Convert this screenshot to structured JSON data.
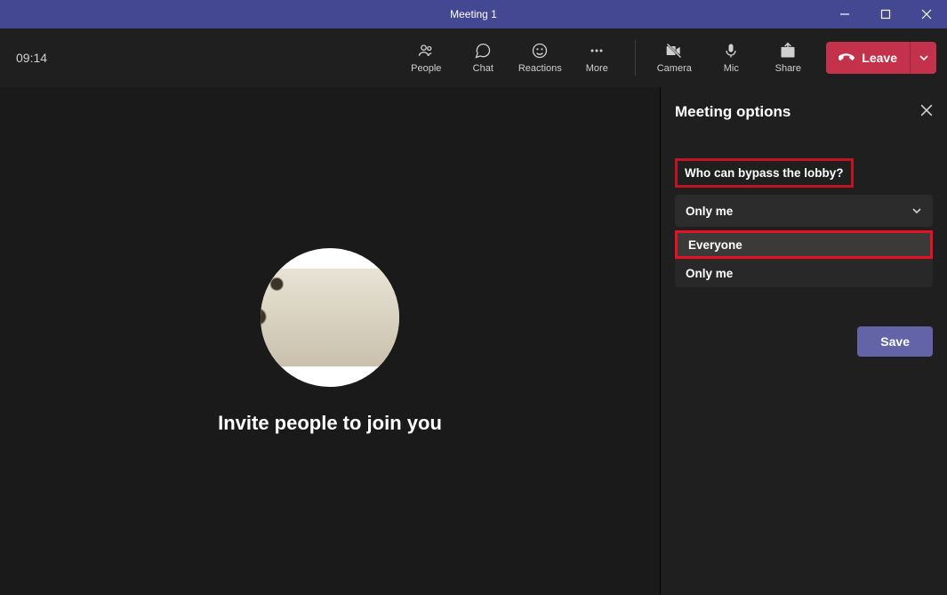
{
  "title": "Meeting 1",
  "timer": "09:14",
  "toolbar": {
    "people": "People",
    "chat": "Chat",
    "reactions": "Reactions",
    "more": "More",
    "camera": "Camera",
    "mic": "Mic",
    "share": "Share",
    "leave": "Leave"
  },
  "stage": {
    "invite_text": "Invite people to join you"
  },
  "panel": {
    "title": "Meeting options",
    "bypass_label": "Who can bypass the lobby?",
    "selected": "Only me",
    "options": {
      "everyone": "Everyone",
      "only_me": "Only me"
    },
    "save": "Save"
  }
}
